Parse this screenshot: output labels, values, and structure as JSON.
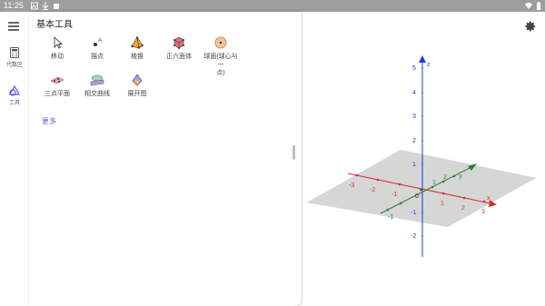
{
  "status_bar": {
    "time": "11:25"
  },
  "rail": {
    "items": [
      {
        "label": "代数区",
        "icon": "calculator-icon"
      },
      {
        "label": "工具",
        "icon": "tools-icon",
        "active": true
      }
    ]
  },
  "panel": {
    "title": "基本工具",
    "tools_row1": [
      {
        "label": "移动",
        "icon": "move-icon"
      },
      {
        "label": "描点",
        "icon": "point-icon"
      },
      {
        "label": "棱锥",
        "icon": "pyramid-icon"
      },
      {
        "label": "正六面体",
        "icon": "cube-icon"
      },
      {
        "label": "球面(球心与一点)",
        "label_line1": "球面(球心与一",
        "label_line2": "点)",
        "icon": "sphere-icon"
      }
    ],
    "tools_row2": [
      {
        "label": "三点平面",
        "icon": "plane-three-points-icon"
      },
      {
        "label": "相交曲线",
        "icon": "intersection-curve-icon"
      },
      {
        "label": "展开图",
        "icon": "net-icon"
      }
    ],
    "more_label": "更多"
  },
  "graphics": {
    "axis_labels": {
      "x": "x",
      "y": "y",
      "z": "z"
    },
    "z_ticks": [
      "5",
      "4",
      "3",
      "2",
      "1",
      "-1",
      "-2"
    ],
    "x_ticks": [
      "-3",
      "-2",
      "-1",
      "1",
      "2",
      "3"
    ],
    "y_ticks": [
      "-1",
      "1",
      "2"
    ],
    "origin": "0",
    "colors": {
      "x_axis": "#d32f2f",
      "y_axis": "#2e7d32",
      "z_axis": "#1a3fc7",
      "plane": "#c8c8c8"
    }
  }
}
